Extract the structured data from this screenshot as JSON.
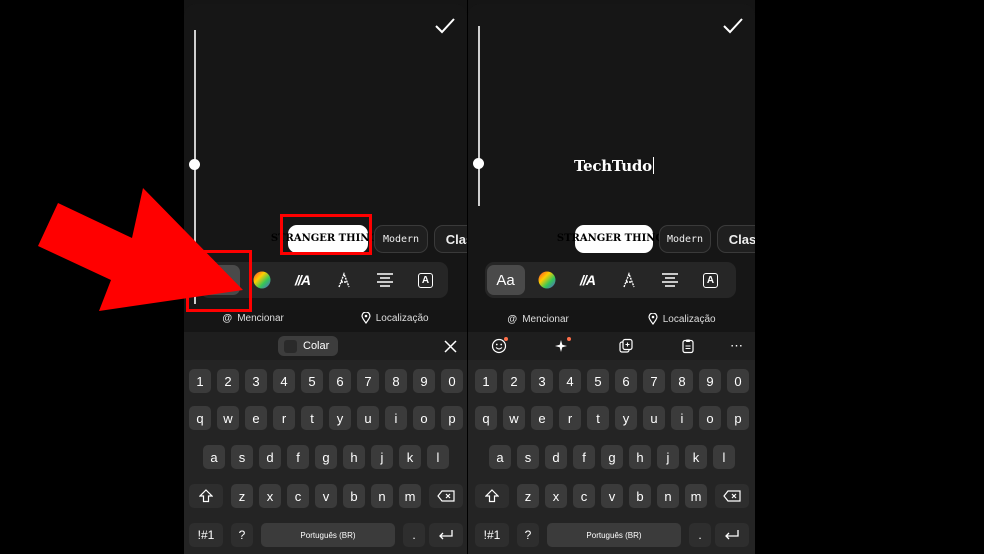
{
  "left_screen": {
    "font_chips": [
      "STRANGER THINGS",
      "Modern",
      "Classic"
    ],
    "text_tools": [
      "Aa",
      "color-wheel",
      "//A",
      "A",
      "align-center",
      "A"
    ],
    "mention_label": "Mencionar",
    "location_label": "Localização",
    "paste_label": "Colar",
    "keyboard": {
      "row_numbers": [
        "1",
        "2",
        "3",
        "4",
        "5",
        "6",
        "7",
        "8",
        "9",
        "0"
      ],
      "row1": [
        "q",
        "w",
        "e",
        "r",
        "t",
        "y",
        "u",
        "i",
        "o",
        "p"
      ],
      "row2": [
        "a",
        "s",
        "d",
        "f",
        "g",
        "h",
        "j",
        "k",
        "l"
      ],
      "row3": [
        "z",
        "x",
        "c",
        "v",
        "b",
        "n",
        "m"
      ],
      "symbols_key": "!#1",
      "question_key": "?",
      "space_label": "Português (BR)",
      "period_key": "."
    }
  },
  "right_screen": {
    "typed_text": "TechTudo",
    "font_chips": [
      "STRANGER THINGS",
      "Modern",
      "Classic"
    ],
    "text_tools": [
      "Aa",
      "color-wheel",
      "//A",
      "A",
      "align-center",
      "A"
    ],
    "mention_label": "Mencionar",
    "location_label": "Localização",
    "keyboard": {
      "row_numbers": [
        "1",
        "2",
        "3",
        "4",
        "5",
        "6",
        "7",
        "8",
        "9",
        "0"
      ],
      "row1": [
        "q",
        "w",
        "e",
        "r",
        "t",
        "y",
        "u",
        "i",
        "o",
        "p"
      ],
      "row2": [
        "a",
        "s",
        "d",
        "f",
        "g",
        "h",
        "j",
        "k",
        "l"
      ],
      "row3": [
        "z",
        "x",
        "c",
        "v",
        "b",
        "n",
        "m"
      ],
      "symbols_key": "!#1",
      "question_key": "?",
      "space_label": "Português (BR)",
      "period_key": "."
    }
  },
  "colors": {
    "highlight": "#ff0000",
    "editor_bg": "#161616",
    "key_bg": "#3b3b3b",
    "toolbar_bg": "#262626"
  }
}
